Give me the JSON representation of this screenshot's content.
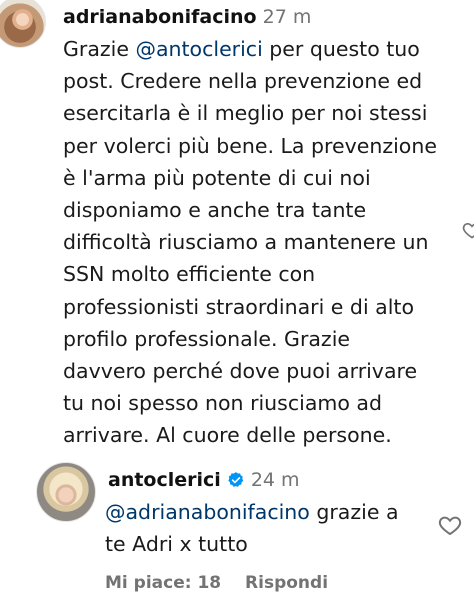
{
  "comment": {
    "username": "adrianabonifacino",
    "time": "27 m",
    "text_lines": [
      [
        "Grazie ",
        "@antoclerici",
        " per questo tuo"
      ],
      [
        "post. Credere nella prevenzione ed"
      ],
      [
        "esercitarla è il meglio per noi stessi"
      ],
      [
        "per volerci più bene. La prevenzione"
      ],
      [
        "è l'arma più potente di cui noi"
      ],
      [
        "disponiamo e anche tra tante"
      ],
      [
        "difficoltà riusciamo a mantenere un"
      ],
      [
        "SSN molto efficiente con"
      ],
      [
        "professionisti straordinari e di alto"
      ],
      [
        "profilo professionale. Grazie"
      ],
      [
        "davvero perché dove puoi arrivare"
      ],
      [
        "tu noi spesso non riusciamo ad"
      ],
      [
        "arrivare. Al cuore delle persone."
      ]
    ]
  },
  "reply": {
    "username": "antoclerici",
    "time": "24 m",
    "mention": "@adrianabonifacino",
    "text_rest_line1": " grazie a",
    "text_line2": "te Adri x tutto",
    "likes_label": "Mi piace: 18",
    "reply_label": "Rispondi"
  },
  "icons": {
    "heart": "heart-outline-icon",
    "verified": "verified-badge-icon"
  },
  "colors": {
    "mention": "#00376b",
    "verified": "#0095f6",
    "meta_text": "#737373"
  }
}
